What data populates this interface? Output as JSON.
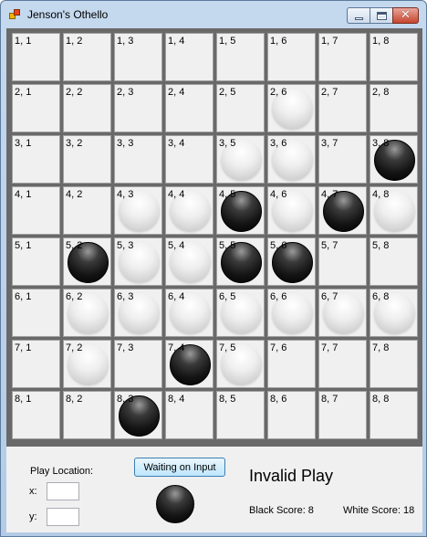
{
  "window": {
    "title": "Jenson's Othello",
    "icon": "app-icon"
  },
  "caption_buttons": {
    "minimize": "minimize-icon",
    "maximize": "maximize-icon",
    "close": "close-icon"
  },
  "board": {
    "rows": [
      [
        {
          "label": "1, 1",
          "piece": ""
        },
        {
          "label": "1, 2",
          "piece": ""
        },
        {
          "label": "1, 3",
          "piece": ""
        },
        {
          "label": "1, 4",
          "piece": ""
        },
        {
          "label": "1, 5",
          "piece": ""
        },
        {
          "label": "1, 6",
          "piece": ""
        },
        {
          "label": "1, 7",
          "piece": ""
        },
        {
          "label": "1, 8",
          "piece": ""
        }
      ],
      [
        {
          "label": "2, 1",
          "piece": ""
        },
        {
          "label": "2, 2",
          "piece": ""
        },
        {
          "label": "2, 3",
          "piece": ""
        },
        {
          "label": "2, 4",
          "piece": ""
        },
        {
          "label": "2, 5",
          "piece": ""
        },
        {
          "label": "2, 6",
          "piece": "white"
        },
        {
          "label": "2, 7",
          "piece": ""
        },
        {
          "label": "2, 8",
          "piece": ""
        }
      ],
      [
        {
          "label": "3, 1",
          "piece": ""
        },
        {
          "label": "3, 2",
          "piece": ""
        },
        {
          "label": "3, 3",
          "piece": ""
        },
        {
          "label": "3, 4",
          "piece": ""
        },
        {
          "label": "3, 5",
          "piece": "white"
        },
        {
          "label": "3, 6",
          "piece": "white"
        },
        {
          "label": "3, 7",
          "piece": ""
        },
        {
          "label": "3, 8",
          "piece": "black"
        }
      ],
      [
        {
          "label": "4, 1",
          "piece": ""
        },
        {
          "label": "4, 2",
          "piece": ""
        },
        {
          "label": "4, 3",
          "piece": "white"
        },
        {
          "label": "4, 4",
          "piece": "white"
        },
        {
          "label": "4, 5",
          "piece": "black"
        },
        {
          "label": "4, 6",
          "piece": "white"
        },
        {
          "label": "4, 7",
          "piece": "black"
        },
        {
          "label": "4, 8",
          "piece": "white"
        }
      ],
      [
        {
          "label": "5, 1",
          "piece": ""
        },
        {
          "label": "5, 2",
          "piece": "black"
        },
        {
          "label": "5, 3",
          "piece": "white"
        },
        {
          "label": "5, 4",
          "piece": "white"
        },
        {
          "label": "5, 5",
          "piece": "black"
        },
        {
          "label": "5, 6",
          "piece": "black"
        },
        {
          "label": "5, 7",
          "piece": ""
        },
        {
          "label": "5, 8",
          "piece": ""
        }
      ],
      [
        {
          "label": "6, 1",
          "piece": ""
        },
        {
          "label": "6, 2",
          "piece": "white"
        },
        {
          "label": "6, 3",
          "piece": "white"
        },
        {
          "label": "6, 4",
          "piece": "white"
        },
        {
          "label": "6, 5",
          "piece": "white"
        },
        {
          "label": "6, 6",
          "piece": "white"
        },
        {
          "label": "6, 7",
          "piece": "white"
        },
        {
          "label": "6, 8",
          "piece": "white"
        }
      ],
      [
        {
          "label": "7, 1",
          "piece": ""
        },
        {
          "label": "7, 2",
          "piece": "white"
        },
        {
          "label": "7, 3",
          "piece": ""
        },
        {
          "label": "7, 4",
          "piece": "black"
        },
        {
          "label": "7, 5",
          "piece": "white"
        },
        {
          "label": "7, 6",
          "piece": ""
        },
        {
          "label": "7, 7",
          "piece": ""
        },
        {
          "label": "7, 8",
          "piece": ""
        }
      ],
      [
        {
          "label": "8, 1",
          "piece": ""
        },
        {
          "label": "8, 2",
          "piece": ""
        },
        {
          "label": "8, 3",
          "piece": "black"
        },
        {
          "label": "8, 4",
          "piece": ""
        },
        {
          "label": "8, 5",
          "piece": ""
        },
        {
          "label": "8, 6",
          "piece": ""
        },
        {
          "label": "8, 7",
          "piece": ""
        },
        {
          "label": "8, 8",
          "piece": ""
        }
      ]
    ]
  },
  "controls": {
    "play_location_label": "Play Location:",
    "x_label": "x:",
    "y_label": "y:",
    "x_value": "",
    "y_value": "",
    "waiting_button": "Waiting on Input",
    "current_turn_piece": "black",
    "status_text": "Invalid Play",
    "black_score": "Black Score: 8",
    "white_score": "White Score: 18"
  },
  "colors": {
    "board_border": "#696969",
    "cell_bg": "#f0f0f0",
    "button_accent": "#3c7fb1",
    "close_red": "#c7452d"
  }
}
